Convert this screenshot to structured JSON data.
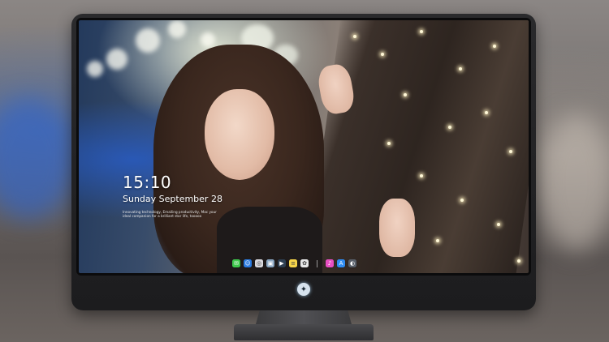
{
  "lock_screen": {
    "time": "15:10",
    "date": "Sunday September 28",
    "tagline": "Innovating technology, Emailing productivity, Mac your ideal companion for a brilliant star life, tooooo"
  },
  "dock": {
    "apps": [
      {
        "name": "messages",
        "glyph": "✉",
        "color": "#3ec84c"
      },
      {
        "name": "finder",
        "glyph": "☺",
        "color": "#2b7be0"
      },
      {
        "name": "safari",
        "glyph": "◎",
        "color": "#d9d9de"
      },
      {
        "name": "preview",
        "glyph": "▣",
        "color": "#8aa6c1"
      },
      {
        "name": "final-cut",
        "glyph": "▶",
        "color": "#2e3f52"
      },
      {
        "name": "notes",
        "glyph": "≡",
        "color": "#f7d54a"
      },
      {
        "name": "photos",
        "glyph": "✿",
        "color": "#e8e8e8"
      }
    ],
    "apps_right": [
      {
        "name": "itunes",
        "glyph": "♪",
        "color": "#e84fc3"
      },
      {
        "name": "app-store",
        "glyph": "A",
        "color": "#2f8cf2"
      },
      {
        "name": "image-capture",
        "glyph": "◐",
        "color": "#59606a"
      }
    ]
  },
  "colors": {
    "accent": "#2b7be0",
    "bezel": "#1c1c1e"
  }
}
